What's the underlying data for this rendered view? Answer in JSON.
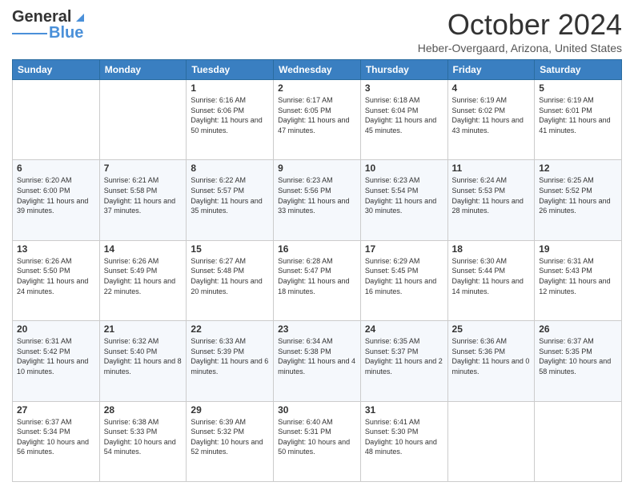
{
  "header": {
    "logo_line1": "General",
    "logo_line2": "Blue",
    "month_title": "October 2024",
    "location": "Heber-Overgaard, Arizona, United States"
  },
  "days_of_week": [
    "Sunday",
    "Monday",
    "Tuesday",
    "Wednesday",
    "Thursday",
    "Friday",
    "Saturday"
  ],
  "weeks": [
    [
      {
        "day": "",
        "info": ""
      },
      {
        "day": "",
        "info": ""
      },
      {
        "day": "1",
        "info": "Sunrise: 6:16 AM\nSunset: 6:06 PM\nDaylight: 11 hours and 50 minutes."
      },
      {
        "day": "2",
        "info": "Sunrise: 6:17 AM\nSunset: 6:05 PM\nDaylight: 11 hours and 47 minutes."
      },
      {
        "day": "3",
        "info": "Sunrise: 6:18 AM\nSunset: 6:04 PM\nDaylight: 11 hours and 45 minutes."
      },
      {
        "day": "4",
        "info": "Sunrise: 6:19 AM\nSunset: 6:02 PM\nDaylight: 11 hours and 43 minutes."
      },
      {
        "day": "5",
        "info": "Sunrise: 6:19 AM\nSunset: 6:01 PM\nDaylight: 11 hours and 41 minutes."
      }
    ],
    [
      {
        "day": "6",
        "info": "Sunrise: 6:20 AM\nSunset: 6:00 PM\nDaylight: 11 hours and 39 minutes."
      },
      {
        "day": "7",
        "info": "Sunrise: 6:21 AM\nSunset: 5:58 PM\nDaylight: 11 hours and 37 minutes."
      },
      {
        "day": "8",
        "info": "Sunrise: 6:22 AM\nSunset: 5:57 PM\nDaylight: 11 hours and 35 minutes."
      },
      {
        "day": "9",
        "info": "Sunrise: 6:23 AM\nSunset: 5:56 PM\nDaylight: 11 hours and 33 minutes."
      },
      {
        "day": "10",
        "info": "Sunrise: 6:23 AM\nSunset: 5:54 PM\nDaylight: 11 hours and 30 minutes."
      },
      {
        "day": "11",
        "info": "Sunrise: 6:24 AM\nSunset: 5:53 PM\nDaylight: 11 hours and 28 minutes."
      },
      {
        "day": "12",
        "info": "Sunrise: 6:25 AM\nSunset: 5:52 PM\nDaylight: 11 hours and 26 minutes."
      }
    ],
    [
      {
        "day": "13",
        "info": "Sunrise: 6:26 AM\nSunset: 5:50 PM\nDaylight: 11 hours and 24 minutes."
      },
      {
        "day": "14",
        "info": "Sunrise: 6:26 AM\nSunset: 5:49 PM\nDaylight: 11 hours and 22 minutes."
      },
      {
        "day": "15",
        "info": "Sunrise: 6:27 AM\nSunset: 5:48 PM\nDaylight: 11 hours and 20 minutes."
      },
      {
        "day": "16",
        "info": "Sunrise: 6:28 AM\nSunset: 5:47 PM\nDaylight: 11 hours and 18 minutes."
      },
      {
        "day": "17",
        "info": "Sunrise: 6:29 AM\nSunset: 5:45 PM\nDaylight: 11 hours and 16 minutes."
      },
      {
        "day": "18",
        "info": "Sunrise: 6:30 AM\nSunset: 5:44 PM\nDaylight: 11 hours and 14 minutes."
      },
      {
        "day": "19",
        "info": "Sunrise: 6:31 AM\nSunset: 5:43 PM\nDaylight: 11 hours and 12 minutes."
      }
    ],
    [
      {
        "day": "20",
        "info": "Sunrise: 6:31 AM\nSunset: 5:42 PM\nDaylight: 11 hours and 10 minutes."
      },
      {
        "day": "21",
        "info": "Sunrise: 6:32 AM\nSunset: 5:40 PM\nDaylight: 11 hours and 8 minutes."
      },
      {
        "day": "22",
        "info": "Sunrise: 6:33 AM\nSunset: 5:39 PM\nDaylight: 11 hours and 6 minutes."
      },
      {
        "day": "23",
        "info": "Sunrise: 6:34 AM\nSunset: 5:38 PM\nDaylight: 11 hours and 4 minutes."
      },
      {
        "day": "24",
        "info": "Sunrise: 6:35 AM\nSunset: 5:37 PM\nDaylight: 11 hours and 2 minutes."
      },
      {
        "day": "25",
        "info": "Sunrise: 6:36 AM\nSunset: 5:36 PM\nDaylight: 11 hours and 0 minutes."
      },
      {
        "day": "26",
        "info": "Sunrise: 6:37 AM\nSunset: 5:35 PM\nDaylight: 10 hours and 58 minutes."
      }
    ],
    [
      {
        "day": "27",
        "info": "Sunrise: 6:37 AM\nSunset: 5:34 PM\nDaylight: 10 hours and 56 minutes."
      },
      {
        "day": "28",
        "info": "Sunrise: 6:38 AM\nSunset: 5:33 PM\nDaylight: 10 hours and 54 minutes."
      },
      {
        "day": "29",
        "info": "Sunrise: 6:39 AM\nSunset: 5:32 PM\nDaylight: 10 hours and 52 minutes."
      },
      {
        "day": "30",
        "info": "Sunrise: 6:40 AM\nSunset: 5:31 PM\nDaylight: 10 hours and 50 minutes."
      },
      {
        "day": "31",
        "info": "Sunrise: 6:41 AM\nSunset: 5:30 PM\nDaylight: 10 hours and 48 minutes."
      },
      {
        "day": "",
        "info": ""
      },
      {
        "day": "",
        "info": ""
      }
    ]
  ]
}
